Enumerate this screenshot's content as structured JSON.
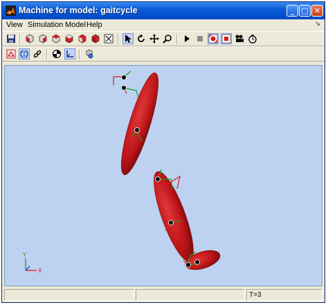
{
  "window": {
    "title": "Machine for model: gaitcycle",
    "controls": {
      "minimize": "_",
      "maximize": "□",
      "close": "✕"
    }
  },
  "menubar": {
    "items": [
      {
        "label": "View"
      },
      {
        "label": "Simulation"
      },
      {
        "label": "Model"
      },
      {
        "label": "Help"
      }
    ]
  },
  "toolbar1": {
    "icons": [
      "save-icon",
      "view-front-icon",
      "view-back-icon",
      "view-top-icon",
      "view-bottom-icon",
      "view-left-icon",
      "view-right-icon",
      "fit-view-icon",
      "select-pointer-icon",
      "rotate-icon",
      "pan-icon",
      "zoom-icon",
      "play-icon",
      "stop-icon",
      "record-start-icon",
      "record-stop-icon",
      "camera-icon",
      "timer-icon"
    ]
  },
  "toolbar2": {
    "icons": [
      "color-icon",
      "globe-icon",
      "link-icon",
      "centers-of-gravity-icon",
      "coordinate-frames-icon",
      "settings-icon"
    ]
  },
  "viewport": {
    "background": "#bcd2f0",
    "body_color": "#c0161a",
    "axis_triad": {
      "x_label": "X",
      "y_label": "Y"
    }
  },
  "statusbar": {
    "time_label": "T=3"
  }
}
